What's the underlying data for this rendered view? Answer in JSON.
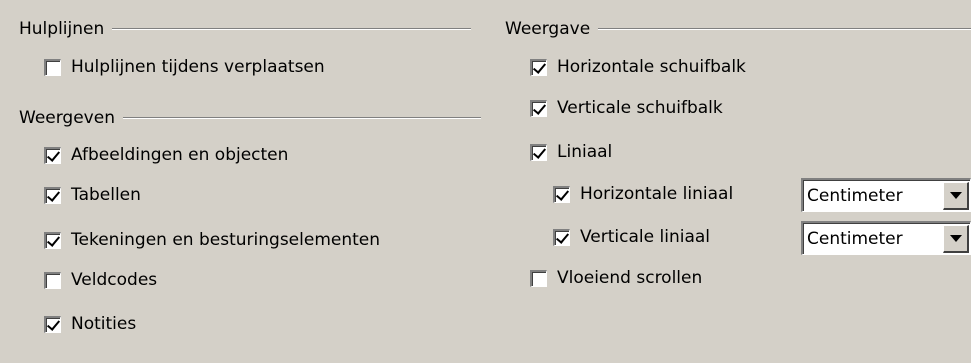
{
  "left": {
    "hulplijnen": {
      "title": "Hulplijnen",
      "items": [
        {
          "label": "Hulplijnen tijdens verplaatsen",
          "checked": false
        }
      ]
    },
    "weergeven": {
      "title": "Weergeven",
      "items": [
        {
          "label": "Afbeeldingen en objecten",
          "checked": true
        },
        {
          "label": "Tabellen",
          "checked": true
        },
        {
          "label": "Tekeningen en besturingselementen",
          "checked": true
        },
        {
          "label": "Veldcodes",
          "checked": false
        },
        {
          "label": "Notities",
          "checked": true
        }
      ]
    }
  },
  "right": {
    "weergave": {
      "title": "Weergave",
      "items": [
        {
          "label": "Horizontale schuifbalk",
          "checked": true
        },
        {
          "label": "Verticale schuifbalk",
          "checked": true
        },
        {
          "label": "Liniaal",
          "checked": true
        },
        {
          "label": "Horizontale liniaal",
          "checked": true
        },
        {
          "label": "Verticale liniaal",
          "checked": true
        },
        {
          "label": "Vloeiend scrollen",
          "checked": false
        }
      ],
      "horizontal_unit": "Centimeter",
      "vertical_unit": "Centimeter"
    }
  }
}
